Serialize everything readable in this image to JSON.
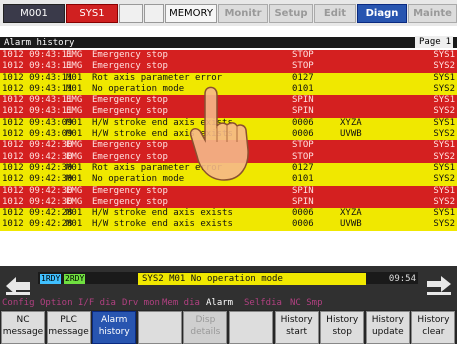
{
  "topbar": {
    "program": "M001",
    "system": "SYS1",
    "memory": "MEMORY",
    "tabs": [
      {
        "label": "Monitr",
        "active": false
      },
      {
        "label": "Setup",
        "active": false
      },
      {
        "label": "Edit",
        "active": false
      },
      {
        "label": "Diagn",
        "active": true
      },
      {
        "label": "Mainte",
        "active": false
      }
    ]
  },
  "panel": {
    "title": "Alarm history",
    "page_label": "Page",
    "page_number": "1"
  },
  "alarms": [
    {
      "time": "1012 09:43:11",
      "code": "EMG",
      "message": "Emergency stop",
      "num": "STOP",
      "axis": "",
      "sys": "SYS1",
      "type": "emg"
    },
    {
      "time": "1012 09:43:11",
      "code": "EMG",
      "message": "Emergency stop",
      "num": "STOP",
      "axis": "",
      "sys": "SYS2",
      "type": "emg"
    },
    {
      "time": "1012 09:43:11",
      "code": "M01",
      "message": "Rot axis parameter error",
      "num": "0127",
      "axis": "",
      "sys": "SYS1",
      "type": "m01"
    },
    {
      "time": "1012 09:43:11",
      "code": "M01",
      "message": "No operation mode",
      "num": "0101",
      "axis": "",
      "sys": "SYS2",
      "type": "m01"
    },
    {
      "time": "1012 09:43:11",
      "code": "EMG",
      "message": "Emergency stop",
      "num": "SPIN",
      "axis": "",
      "sys": "SYS1",
      "type": "emg"
    },
    {
      "time": "1012 09:43:11",
      "code": "EMG",
      "message": "Emergency stop",
      "num": "SPIN",
      "axis": "",
      "sys": "SYS2",
      "type": "emg"
    },
    {
      "time": "1012 09:43:09",
      "code": "M01",
      "message": "H/W stroke end axis exists",
      "num": "0006",
      "axis": "XYZA",
      "sys": "SYS1",
      "type": "m01"
    },
    {
      "time": "1012 09:43:09",
      "code": "M01",
      "message": "H/W stroke end axis exists",
      "num": "0006",
      "axis": "UVWB",
      "sys": "SYS2",
      "type": "m01"
    },
    {
      "time": "1012 09:42:30",
      "code": "EMG",
      "message": "Emergency stop",
      "num": "STOP",
      "axis": "",
      "sys": "SYS1",
      "type": "emg"
    },
    {
      "time": "1012 09:42:30",
      "code": "EMG",
      "message": "Emergency stop",
      "num": "STOP",
      "axis": "",
      "sys": "SYS2",
      "type": "emg"
    },
    {
      "time": "1012 09:42:30",
      "code": "M01",
      "message": "Rot axis parameter error",
      "num": "0127",
      "axis": "",
      "sys": "SYS1",
      "type": "m01"
    },
    {
      "time": "1012 09:42:30",
      "code": "M01",
      "message": "No operation mode",
      "num": "0101",
      "axis": "",
      "sys": "SYS2",
      "type": "m01"
    },
    {
      "time": "1012 09:42:30",
      "code": "EMG",
      "message": "Emergency stop",
      "num": "SPIN",
      "axis": "",
      "sys": "SYS1",
      "type": "emg"
    },
    {
      "time": "1012 09:42:30",
      "code": "EMG",
      "message": "Emergency stop",
      "num": "SPIN",
      "axis": "",
      "sys": "SYS2",
      "type": "emg"
    },
    {
      "time": "1012 09:42:28",
      "code": "M01",
      "message": "H/W stroke end axis exists",
      "num": "0006",
      "axis": "XYZA",
      "sys": "SYS1",
      "type": "m01"
    },
    {
      "time": "1012 09:42:28",
      "code": "M01",
      "message": "H/W stroke end axis exists",
      "num": "0006",
      "axis": "UVWB",
      "sys": "SYS2",
      "type": "m01"
    }
  ],
  "status": {
    "rdy1": "1RDY",
    "rdy2": "2RDY",
    "alarm_message": "SYS2 M01  No operation mode",
    "clock": "09:54"
  },
  "menu_path": [
    {
      "label": "Config",
      "active": false
    },
    {
      "label": "Option",
      "active": false
    },
    {
      "label": "I/F dia",
      "active": false
    },
    {
      "label": "Drv mon",
      "active": false
    },
    {
      "label": "Mem dia",
      "active": false
    },
    {
      "label": "Alarm",
      "active": true
    },
    {
      "label": "Selfdia",
      "active": false
    },
    {
      "label": "NC Smp",
      "active": false
    }
  ],
  "function_keys": [
    {
      "line1": "NC",
      "line2": "message",
      "state": "normal"
    },
    {
      "line1": "PLC",
      "line2": "message",
      "state": "normal"
    },
    {
      "line1": "Alarm",
      "line2": "history",
      "state": "selected"
    },
    {
      "line1": "",
      "line2": "",
      "state": "normal"
    },
    {
      "line1": "Disp",
      "line2": "details",
      "state": "dim"
    },
    {
      "line1": "",
      "line2": "",
      "state": "normal"
    },
    {
      "line1": "History",
      "line2": "start",
      "state": "normal"
    },
    {
      "line1": "History",
      "line2": "stop",
      "state": "normal"
    },
    {
      "line1": "History",
      "line2": "update",
      "state": "normal"
    },
    {
      "line1": "History",
      "line2": "clear",
      "state": "normal"
    }
  ],
  "colors": {
    "emg_row": "#d42020",
    "m01_row": "#f0e800",
    "active_tab": "#2855b0"
  }
}
